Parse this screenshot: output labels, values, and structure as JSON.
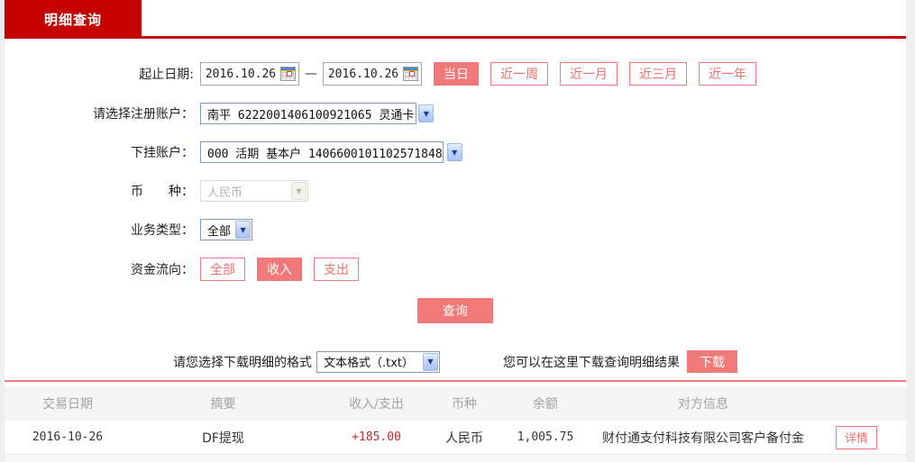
{
  "tab": {
    "label": "明细查询"
  },
  "form": {
    "date_range": {
      "label": "起止日期:",
      "start": "2016.10.26",
      "end": "2016.10.26",
      "separator": "—",
      "quick_buttons": [
        {
          "label": "当日",
          "active": true
        },
        {
          "label": "近一周",
          "active": false
        },
        {
          "label": "近一月",
          "active": false
        },
        {
          "label": "近三月",
          "active": false
        },
        {
          "label": "近一年",
          "active": false
        }
      ]
    },
    "register_account": {
      "label": "请选择注册账户：",
      "value": "南平 6222001406100921065 灵通卡"
    },
    "sub_account": {
      "label": "下挂账户：",
      "value": "000 活期 基本户 1406600101102571848"
    },
    "currency": {
      "label": "币　　种：",
      "value": "人民币",
      "disabled": true
    },
    "business_type": {
      "label": "业务类型：",
      "value": "全部"
    },
    "fund_flow": {
      "label": "资金流向：",
      "options": [
        {
          "label": "全部",
          "active": false
        },
        {
          "label": "收入",
          "active": true
        },
        {
          "label": "支出",
          "active": false
        }
      ]
    },
    "query_button": "查询"
  },
  "download": {
    "format_label": "请您选择下载明细的格式",
    "format_value": "文本格式（.txt）",
    "hint": "您可以在这里下载查询明细结果",
    "button": "下载"
  },
  "table": {
    "headers": [
      "交易日期",
      "摘要",
      "收入/支出",
      "币种",
      "余额",
      "对方信息"
    ],
    "rows": [
      {
        "date": "2016-10-26",
        "summary": "DF提现",
        "amount": "+185.00",
        "currency": "人民币",
        "balance": "1,005.75",
        "counterparty": "财付通支付科技有限公司客户备付金",
        "action": "详情"
      }
    ]
  },
  "colors": {
    "brand_red": "#c40000",
    "salmon": "#f1797a",
    "amount_red": "#cc2626",
    "header_gray": "#a3a3a3"
  }
}
